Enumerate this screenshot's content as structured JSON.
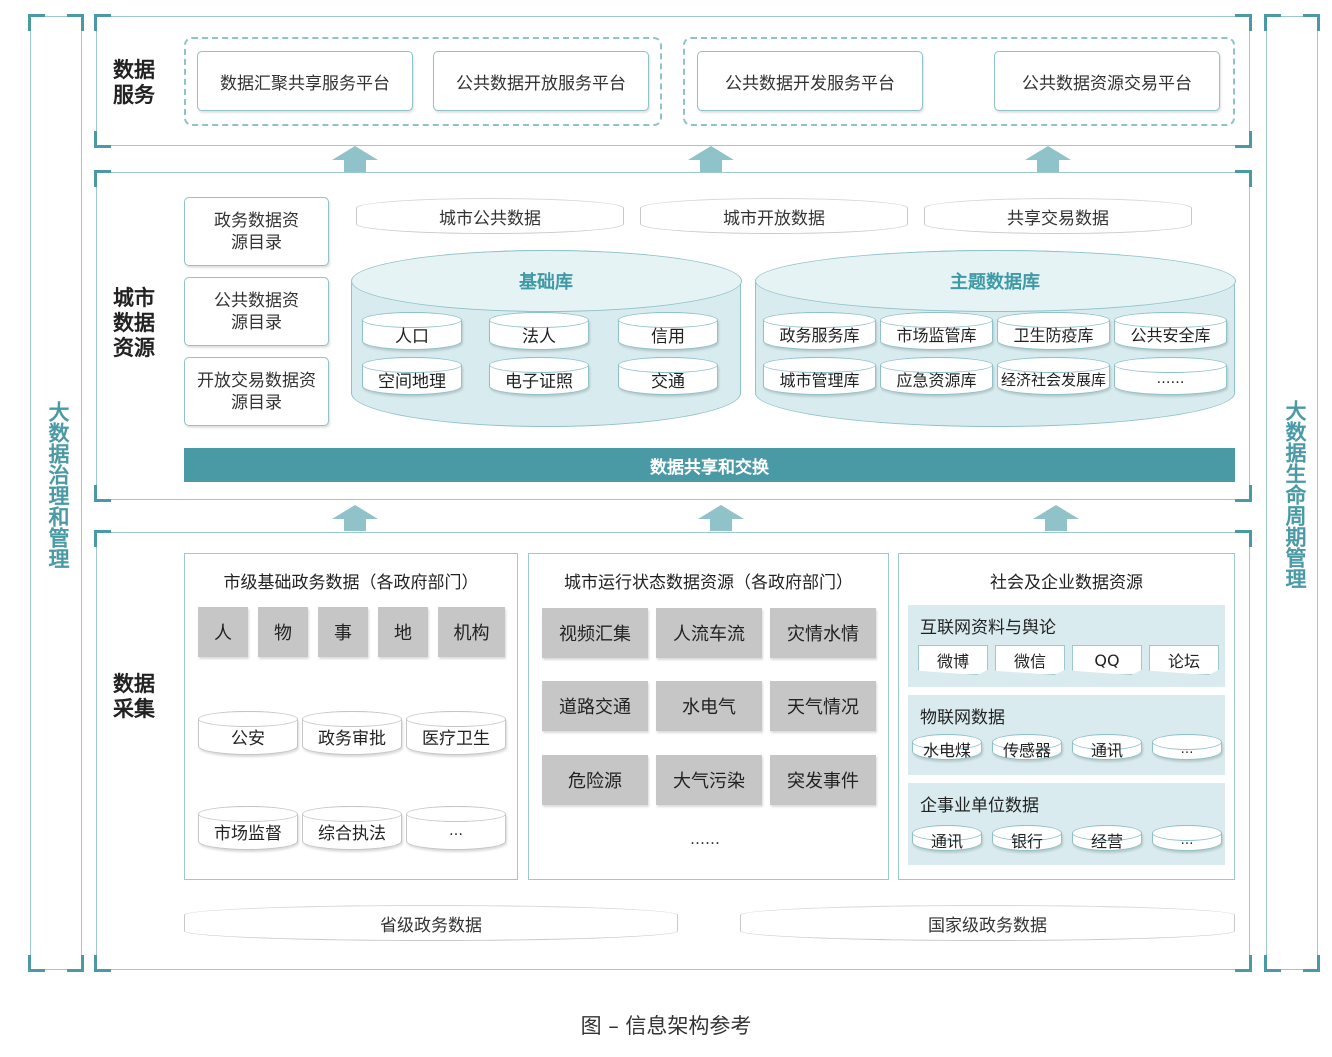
{
  "side": {
    "left": "大数据治理和管理",
    "right": "大数据生命周期管理"
  },
  "service": {
    "label": "数据服务",
    "platforms": [
      "数据汇聚共享服务平台",
      "公共数据开放服务平台",
      "公共数据开发服务平台",
      "公共数据资源交易平台"
    ]
  },
  "resource": {
    "label": "城市数据资源",
    "catalogs": [
      "政务数据资源目录",
      "公共数据资源目录",
      "开放交易数据资源目录"
    ],
    "top_data": [
      "城市公共数据",
      "城市开放数据",
      "共享交易数据"
    ],
    "base_db": {
      "title": "基础库",
      "items": [
        "人口",
        "法人",
        "信用",
        "空间地理",
        "电子证照",
        "交通"
      ]
    },
    "theme_db": {
      "title": "主题数据库",
      "items": [
        "政务服务库",
        "市场监管库",
        "卫生防疫库",
        "公共安全库",
        "城市管理库",
        "应急资源库",
        "经济社会发展库",
        "……"
      ]
    },
    "exchange_bar": "数据共享和交换"
  },
  "collect": {
    "label": "数据采集",
    "col1": {
      "title": "市级基础政务数据（各政府部门）",
      "gray": [
        "人",
        "物",
        "事",
        "地",
        "机构"
      ],
      "cyl_row1": [
        "公安",
        "政务审批",
        "医疗卫生"
      ],
      "cyl_row2": [
        "市场监督",
        "综合执法",
        "…"
      ]
    },
    "col2": {
      "title": "城市运行状态数据资源（各政府部门）",
      "gray": [
        "视频汇集",
        "人流车流",
        "灾情水情",
        "道路交通",
        "水电气",
        "天气情况",
        "危险源",
        "大气污染",
        "突发事件"
      ],
      "more": "……"
    },
    "col3": {
      "title": "社会及企业数据资源",
      "groups": [
        {
          "title": "互联网资料与舆论",
          "items": [
            "微博",
            "微信",
            "QQ",
            "论坛"
          ]
        },
        {
          "title": "物联网数据",
          "items": [
            "水电煤",
            "传感器",
            "通讯",
            "…"
          ]
        },
        {
          "title": "企事业单位数据",
          "items": [
            "通讯",
            "银行",
            "经营",
            "…"
          ]
        }
      ]
    },
    "bottom": [
      "省级政务数据",
      "国家级政务数据"
    ]
  },
  "caption": "图 – 信息架构参考",
  "colors": {
    "accent": "#4a9aa6",
    "light": "#d9ebee",
    "gray": "#c6c6c6"
  }
}
